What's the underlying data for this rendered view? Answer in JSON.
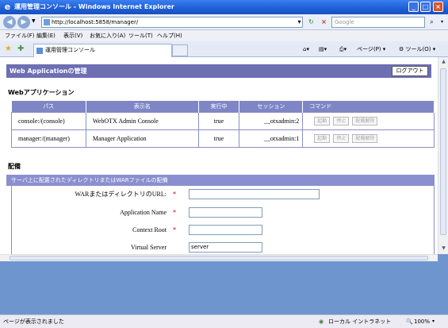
{
  "window": {
    "title": "運用管理コンソール - Windows Internet Explorer"
  },
  "address": {
    "url": "http://localhost:5858/manager/",
    "search_placeholder": "Google"
  },
  "menu": [
    "ファイル(F)",
    "編集(E)",
    "表示(V)",
    "お気に入り(A)",
    "ツール(T)",
    "ヘルプ(H)"
  ],
  "tab": {
    "label": "運用管理コンソール"
  },
  "toolbar": {
    "page": "ページ(P)",
    "tools": "ツール(O)"
  },
  "page": {
    "header": "Web Applicationの管理",
    "logout": "ログアウト",
    "apps_title": "Webアプリケーション",
    "columns": [
      "パス",
      "表示名",
      "実行中",
      "セッション",
      "コマンド"
    ],
    "apps": [
      {
        "path": "console:/(console)",
        "name": "WebOTX Admin Console",
        "running": "true",
        "session": "__otxadmin:2"
      },
      {
        "path": "manager:/(manager)",
        "name": "Manager Application",
        "running": "true",
        "session": "__otxadmin:1"
      }
    ],
    "commands": [
      "起動",
      "停止",
      "配備解除"
    ],
    "deploy_title": "配備",
    "deploy_subtitle": "サーバ上に配置されたディレクトリまたはWARファイルの配備",
    "form": {
      "war_label": "WARまたはディレクトリのURL:",
      "app_name_label": "Application Name",
      "context_root_label": "Context Root",
      "virtual_server_label": "Virtual Server",
      "virtual_server_value": "server",
      "required_mark": "*"
    }
  },
  "status": {
    "text": "ページが表示されました",
    "zone": "ローカル イントラネット",
    "zoom": "100%"
  }
}
